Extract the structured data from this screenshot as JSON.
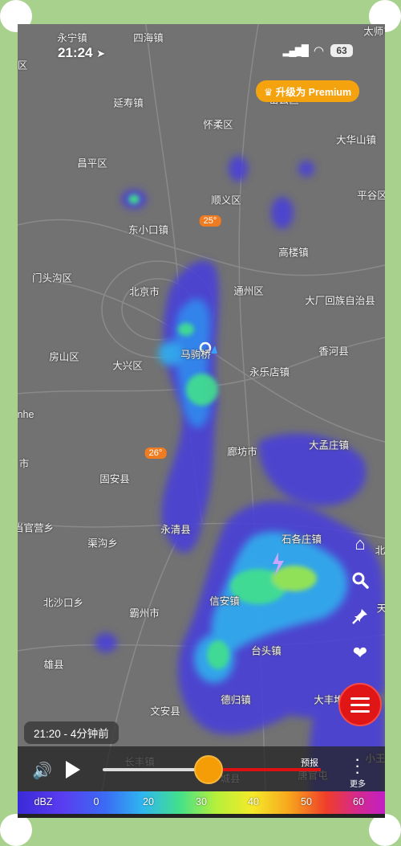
{
  "status_bar": {
    "time": "21:24",
    "battery": "63"
  },
  "premium_label": "升级为 Premium",
  "map_labels": [
    {
      "text": "永宁镇"
    },
    {
      "text": "四海镇"
    },
    {
      "text": "太师屯"
    },
    {
      "text": "区"
    },
    {
      "text": "延寿镇"
    },
    {
      "text": "密云区"
    },
    {
      "text": "怀柔区"
    },
    {
      "text": "大华山镇"
    },
    {
      "text": "昌平区"
    },
    {
      "text": "顺义区"
    },
    {
      "text": "平谷区"
    },
    {
      "text": "东小口镇"
    },
    {
      "text": "高楼镇"
    },
    {
      "text": "门头沟区"
    },
    {
      "text": "北京市"
    },
    {
      "text": "通州区"
    },
    {
      "text": "大厂回族自治县"
    },
    {
      "text": "马驹桥"
    },
    {
      "text": "房山区"
    },
    {
      "text": "大兴区"
    },
    {
      "text": "香河县"
    },
    {
      "text": "永乐店镇"
    },
    {
      "text": "nhe"
    },
    {
      "text": "大孟庄镇"
    },
    {
      "text": "廊坊市"
    },
    {
      "text": "市"
    },
    {
      "text": "固安县"
    },
    {
      "text": "当官营乡"
    },
    {
      "text": "永清县"
    },
    {
      "text": "石各庄镇"
    },
    {
      "text": "北"
    },
    {
      "text": "渠沟乡"
    },
    {
      "text": "北沙口乡"
    },
    {
      "text": "信安镇"
    },
    {
      "text": "霸州市"
    },
    {
      "text": "天"
    },
    {
      "text": "台头镇"
    },
    {
      "text": "雄县"
    },
    {
      "text": "德归镇"
    },
    {
      "text": "文安县"
    },
    {
      "text": "大丰堆"
    },
    {
      "text": "长丰镇"
    },
    {
      "text": "城县"
    },
    {
      "text": "唐官屯"
    },
    {
      "text": "小王"
    }
  ],
  "temperatures": [
    "25°",
    "26°"
  ],
  "timestamp": "21:20 - 4分钟前",
  "player": {
    "forecast_label": "预报",
    "more_label": "更多",
    "progress": 0.43
  },
  "legend": {
    "unit": "dBZ",
    "ticks": [
      "0",
      "20",
      "30",
      "40",
      "50",
      "60"
    ]
  },
  "colors": {
    "premium": "#f5a20f",
    "menu": "#e01515",
    "thumb": "#f59d07",
    "forecast_track": "#dd1111"
  },
  "icons": [
    "location-arrow-icon",
    "signal-icon",
    "wifi-icon",
    "crown-icon",
    "home-icon",
    "search-icon",
    "pin-icon",
    "heart-icon",
    "menu-icon",
    "speaker-icon",
    "play-icon",
    "more-icon",
    "lightning-icon",
    "location-marker-icon"
  ]
}
